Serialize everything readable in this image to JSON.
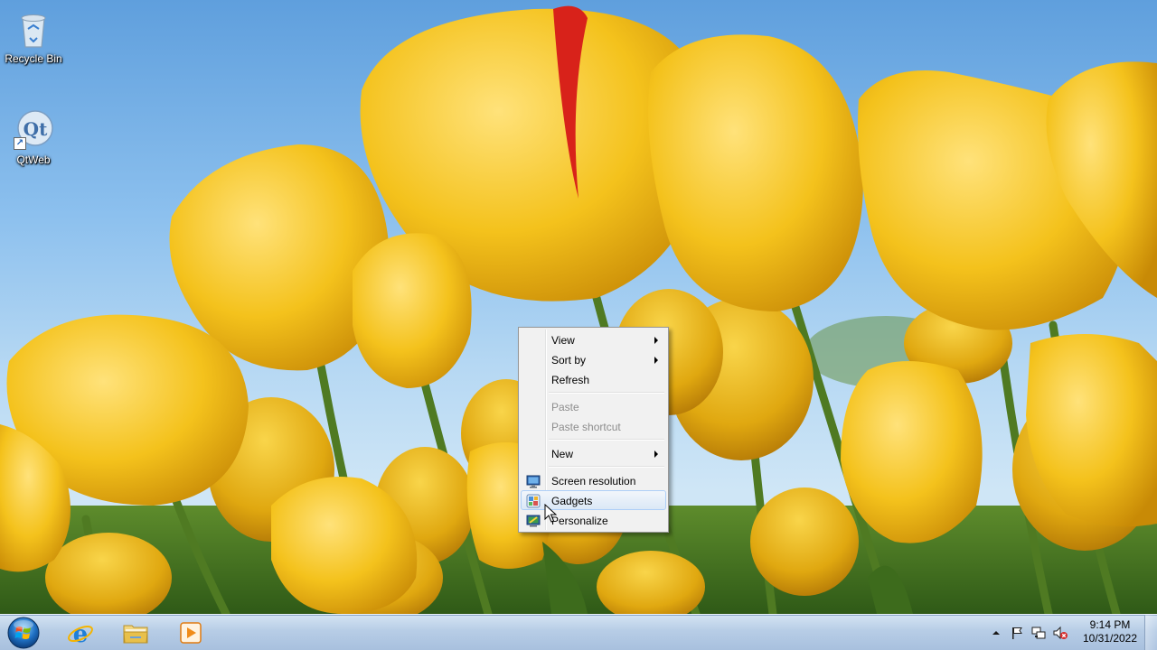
{
  "desktop": {
    "icons": [
      {
        "label": "Recycle Bin",
        "icon": "recycle-bin-icon"
      },
      {
        "label": "QtWeb",
        "icon": "qtweb-icon"
      }
    ]
  },
  "context_menu": {
    "items": [
      {
        "label": "View",
        "submenu": true,
        "disabled": false
      },
      {
        "label": "Sort by",
        "submenu": true,
        "disabled": false
      },
      {
        "label": "Refresh",
        "submenu": false,
        "disabled": false
      },
      {
        "label": "Paste",
        "submenu": false,
        "disabled": true
      },
      {
        "label": "Paste shortcut",
        "submenu": false,
        "disabled": true
      },
      {
        "label": "New",
        "submenu": true,
        "disabled": false
      },
      {
        "label": "Screen resolution",
        "icon": "screen-resolution-icon"
      },
      {
        "label": "Gadgets",
        "icon": "gadgets-icon",
        "highlighted": true
      },
      {
        "label": "Personalize",
        "icon": "personalize-icon"
      }
    ]
  },
  "taskbar": {
    "start_button": "windows-start-orb",
    "pinned": [
      {
        "name": "Internet Explorer",
        "icon": "internet-explorer-icon"
      },
      {
        "name": "Windows Explorer",
        "icon": "folder-icon"
      },
      {
        "name": "Windows Media Player",
        "icon": "media-player-icon"
      }
    ],
    "tray": {
      "icons": [
        "show-hidden-icons-arrow",
        "action-center-flag-icon",
        "network-icon",
        "volume-muted-icon"
      ],
      "time": "9:14 PM",
      "date": "10/31/2022"
    }
  },
  "colors": {
    "menu_highlight_border": "#aecff7",
    "taskbar": "#b7cde6",
    "tulip_yellow": "#f2c21b"
  }
}
